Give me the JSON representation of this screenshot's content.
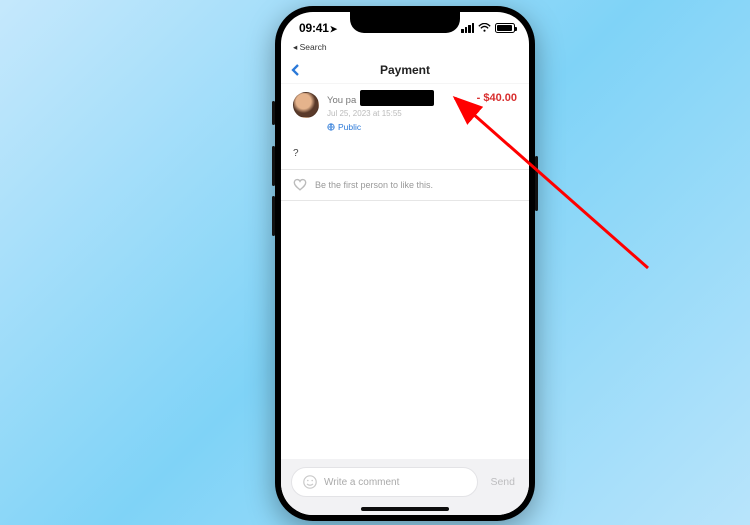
{
  "status_bar": {
    "time": "09:41",
    "back_app": "◂ Search"
  },
  "header": {
    "title": "Payment"
  },
  "transaction": {
    "you_paid_prefix": "You pa",
    "meta": "Jul 25, 2023 at 15:55",
    "privacy": "Public",
    "amount": "- $40.00",
    "note": "?"
  },
  "like_row": {
    "text": "Be the first person to like this."
  },
  "comment_bar": {
    "placeholder": "Write a comment",
    "send": "Send"
  }
}
